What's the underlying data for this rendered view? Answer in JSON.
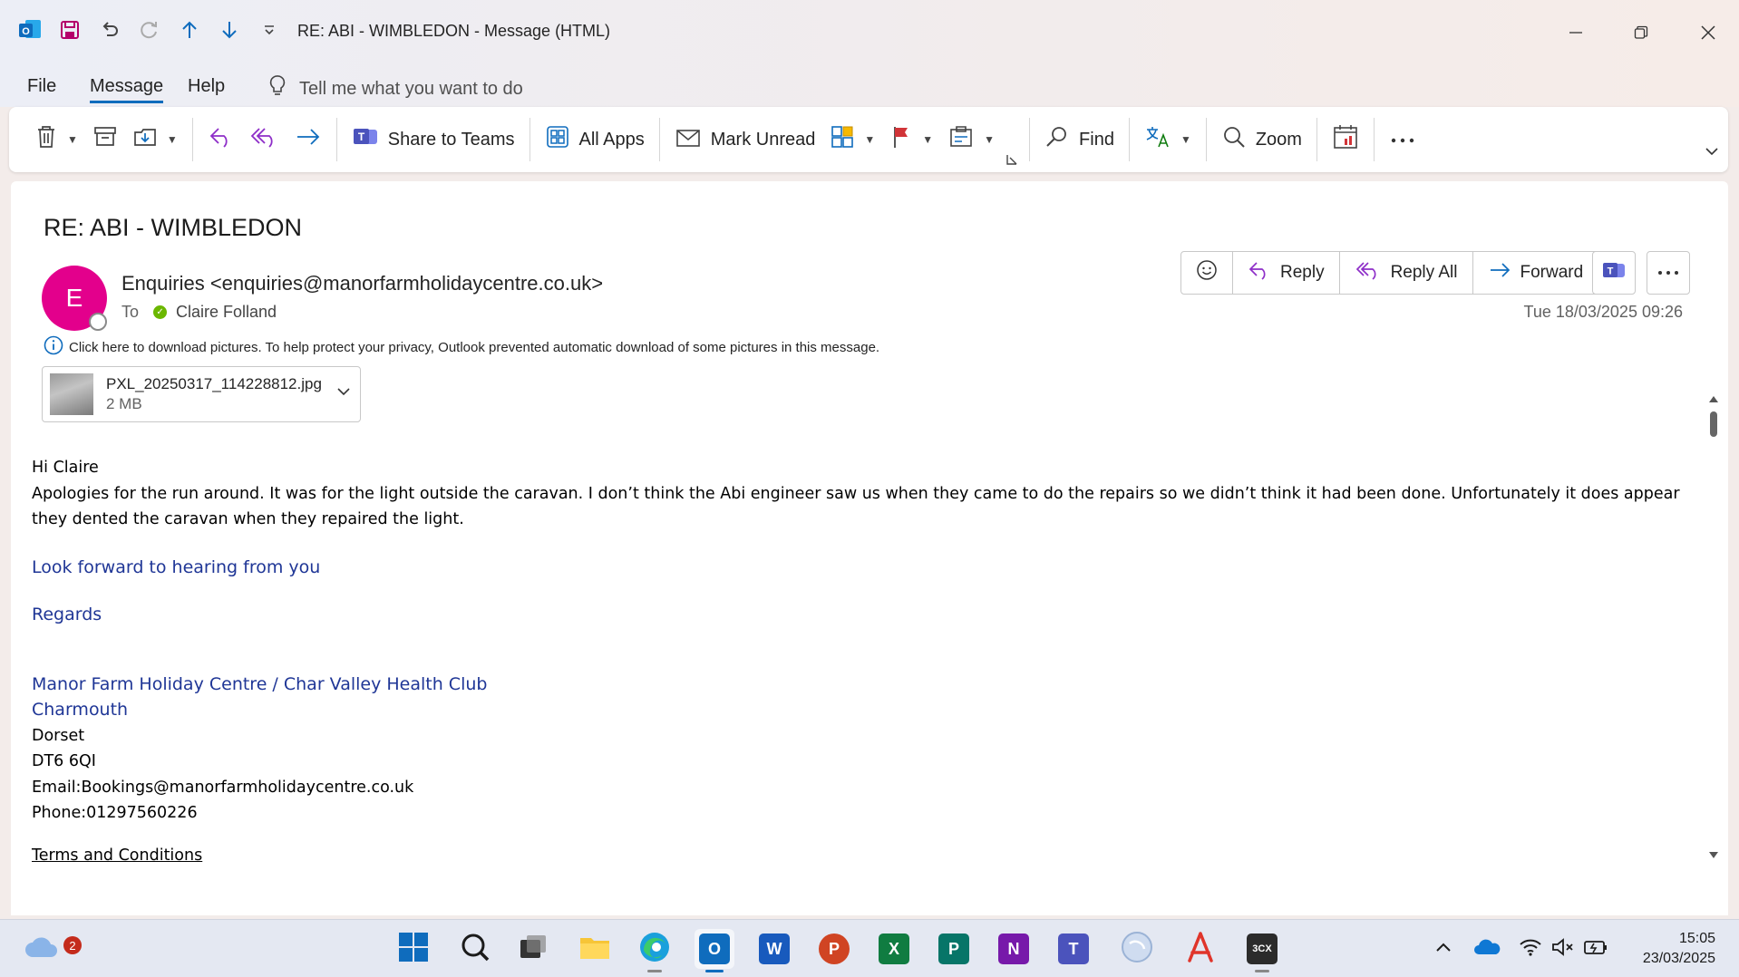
{
  "window": {
    "title": "RE: ABI - WIMBLEDON  -  Message (HTML)"
  },
  "menu": {
    "file": "File",
    "message": "Message",
    "help": "Help",
    "tell_me": "Tell me what you want to do"
  },
  "ribbon": {
    "share_to_teams": "Share to Teams",
    "all_apps": "All Apps",
    "mark_unread": "Mark Unread",
    "find": "Find",
    "zoom": "Zoom"
  },
  "message": {
    "subject": "RE: ABI - WIMBLEDON",
    "avatar_initial": "E",
    "from": "Enquiries <enquiries@manorfarmholidaycentre.co.uk>",
    "to_label": "To",
    "to": "Claire Folland",
    "date": "Tue 18/03/2025 09:26",
    "info_bar": "Click here to download pictures. To help protect your privacy, Outlook prevented automatic download of some pictures in this message.",
    "attachment": {
      "name": "PXL_20250317_114228812.jpg",
      "size": "2 MB"
    }
  },
  "actions": {
    "reply": "Reply",
    "reply_all": "Reply All",
    "forward": "Forward"
  },
  "body": {
    "greeting": "Hi Claire",
    "paragraph": "Apologies for the run around. It was for the light outside the caravan. I don’t think the Abi engineer saw us when they came to do the repairs so we didn’t think it had been done. Unfortunately it does appear they dented the caravan when they repaired the light.",
    "look_forward": "Look forward to hearing from you",
    "regards": "Regards",
    "sig_company": "Manor Farm Holiday Centre / Char Valley Health Club",
    "sig_town": "Charmouth",
    "sig_county": "Dorset",
    "sig_postcode": "DT6 6QI",
    "sig_email": "Email:Bookings@manorfarmholidaycentre.co.uk",
    "sig_phone": "Phone:01297560226",
    "terms": "Terms and Conditions"
  },
  "taskbar": {
    "weather_badge": "2",
    "time": "15:05",
    "date": "23/03/2025"
  },
  "colors": {
    "accent": "#0f6cbd",
    "avatar": "#e3008c",
    "signature_blue": "#1f3696"
  }
}
